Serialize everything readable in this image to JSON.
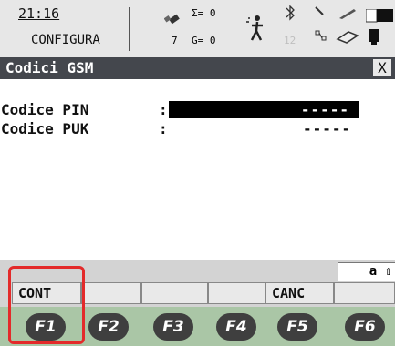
{
  "status": {
    "time": "21:16",
    "mode": "CONFIGURA",
    "sigma_value": "Σ= 0",
    "sat_count": "7",
    "glonass": "G= 0",
    "channel": "12",
    "icons": [
      "satellite-icon",
      "person-icon",
      "bluetooth-icon",
      "pen-icon",
      "link-icon",
      "eraser-icon",
      "battery-icon"
    ]
  },
  "window": {
    "title": "Codici GSM",
    "close_label": "X"
  },
  "form": {
    "pin_label": "Codice PIN",
    "puk_label": "Codice PUK",
    "colon": ":",
    "pin_value": "-----",
    "puk_value": "-----"
  },
  "input_mode": "a ⇧",
  "softkeys": [
    "CONT",
    "",
    "",
    "",
    "CANC",
    ""
  ],
  "fkeys": [
    "F1",
    "F2",
    "F3",
    "F4",
    "F5",
    "F6"
  ],
  "colors": {
    "titlebar": "#44474d",
    "fbar": "#aac6a6",
    "highlight": "#e32a2a"
  }
}
